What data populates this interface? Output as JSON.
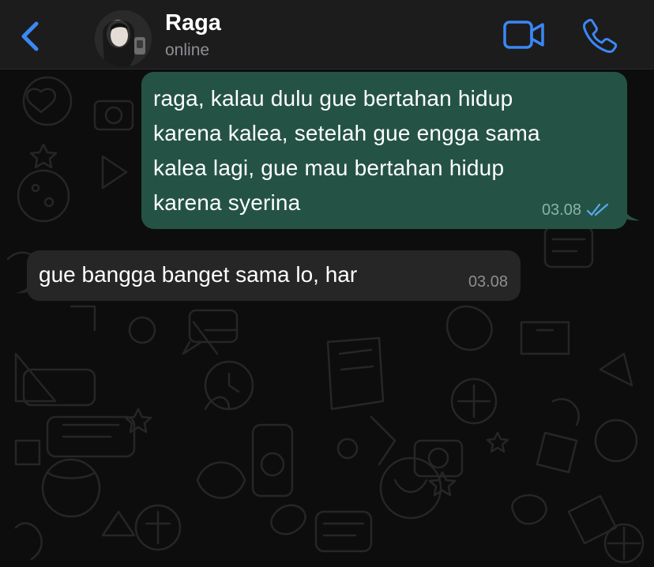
{
  "header": {
    "contact_name": "Raga",
    "contact_status": "online",
    "accent_color": "#3b88f5",
    "icons": [
      "back-chevron-icon",
      "video-camera-icon",
      "phone-icon"
    ]
  },
  "messages": [
    {
      "direction": "outgoing",
      "text": "raga, kalau dulu gue bertahan hidup\nkarena kalea, setelah gue engga sama\nkalea lagi, gue mau bertahan hidup\nkarena syerina",
      "time": "03.08",
      "status": "read",
      "bubble_color": "#245346"
    },
    {
      "direction": "incoming",
      "text": "gue bangga banget sama lo, har",
      "time": "03.08",
      "bubble_color": "#262626"
    }
  ]
}
